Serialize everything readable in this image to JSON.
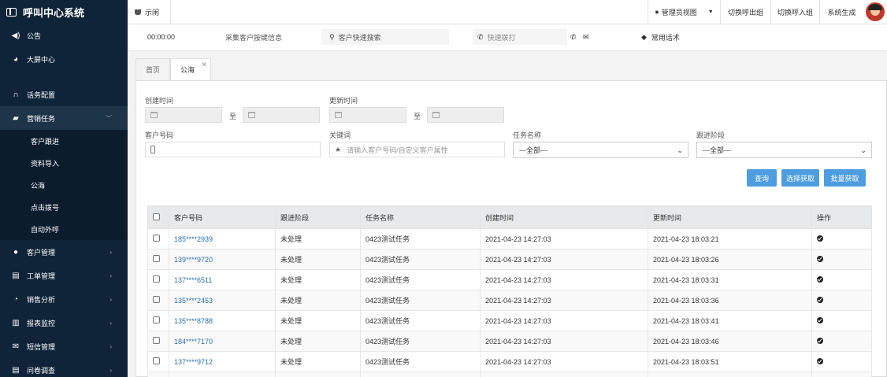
{
  "app": {
    "title": "呼叫中心系统"
  },
  "sidebar": {
    "items_top": [
      {
        "label": "公告",
        "icon": "volume-icon"
      },
      {
        "label": "大屏中心",
        "icon": "pie-chart-icon"
      }
    ],
    "items_mid": [
      {
        "label": "话务配置",
        "icon": "headset-icon"
      }
    ],
    "marketing": {
      "label": "营销任务",
      "icon": "briefcase-icon",
      "children": [
        "客户跟进",
        "资料导入",
        "公海",
        "点击拨号",
        "自动外呼"
      ]
    },
    "items_bottom": [
      {
        "label": "客户管理",
        "icon": "user-icon"
      },
      {
        "label": "工单管理",
        "icon": "file-icon"
      },
      {
        "label": "销售分析",
        "icon": "pie-icon"
      },
      {
        "label": "报表监控",
        "icon": "bar-chart-icon"
      },
      {
        "label": "短信管理",
        "icon": "envelope-icon"
      },
      {
        "label": "问卷调查",
        "icon": "survey-icon"
      }
    ]
  },
  "topbar": {
    "status": "示闲",
    "admin_view": "管理员视图",
    "switch_out_group": "切换呼出组",
    "switch_in_group": "切换呼入组",
    "system_generate": "系统生成"
  },
  "toolbar": {
    "timer": "00:00:00",
    "collect_button": "采集客户按键信息",
    "search_placeholder": "客户快速搜索",
    "dial_placeholder": "快速拨打",
    "common_scripts": "常用话术"
  },
  "tabs": [
    "首页",
    "公海"
  ],
  "filters": {
    "created_label": "创建时间",
    "updated_label": "更新时间",
    "to": "至",
    "phone_label": "客户号码",
    "keyword_label": "关键词",
    "keyword_placeholder": "请输入客户号码/自定义客户属性",
    "task_label": "任务名称",
    "task_value": "---全部---",
    "stage_label": "跟进阶段",
    "stage_value": "---全部---"
  },
  "buttons": {
    "query": "查询",
    "select_get": "选择获取",
    "batch_get": "批量获取"
  },
  "table": {
    "headers": [
      "客户号码",
      "跟进阶段",
      "任务名称",
      "创建时间",
      "更新时间",
      "操作"
    ],
    "rows": [
      [
        "185****2939",
        "未处理",
        "0423测试任务",
        "2021-04-23 14:27:03",
        "2021-04-23 18:03:21"
      ],
      [
        "139****9720",
        "未处理",
        "0423测试任务",
        "2021-04-23 14:27:03",
        "2021-04-23 18:03:26"
      ],
      [
        "137****6511",
        "未处理",
        "0423测试任务",
        "2021-04-23 14:27:03",
        "2021-04-23 18:03:31"
      ],
      [
        "135****2453",
        "未处理",
        "0423测试任务",
        "2021-04-23 14:27:03",
        "2021-04-23 18:03:36"
      ],
      [
        "135****8788",
        "未处理",
        "0423测试任务",
        "2021-04-23 14:27:03",
        "2021-04-23 18:03:41"
      ],
      [
        "184****7170",
        "未处理",
        "0423测试任务",
        "2021-04-23 14:27:03",
        "2021-04-23 18:03:46"
      ],
      [
        "137****9712",
        "未处理",
        "0423测试任务",
        "2021-04-23 14:27:03",
        "2021-04-23 18:03:51"
      ],
      [
        "",
        "",
        "",
        "",
        ""
      ]
    ]
  },
  "colors": {
    "sidebar": "#0f2438",
    "accent": "#4d9de0",
    "link": "#2a6fa8"
  }
}
